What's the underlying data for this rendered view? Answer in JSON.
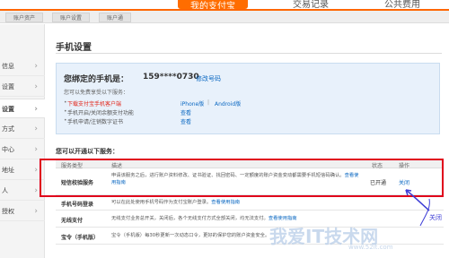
{
  "topnav": {
    "partial_left": "",
    "active": "我的支付宝",
    "item2": "交易记录",
    "item3": "公共费用"
  },
  "subnav": {
    "items": [
      "账户资产",
      "账户设置",
      "账户通"
    ]
  },
  "sidebar": {
    "items": [
      "信息",
      "设置",
      "设置",
      "方式",
      "中心",
      "地址",
      "人",
      "授权"
    ],
    "active_index": 2
  },
  "page": {
    "title": "手机设置"
  },
  "infobox": {
    "bound_label": "您绑定的手机是：",
    "phone": "159****0730",
    "modify_link": "修改号码",
    "services_intro": "您可以免费享受以下服务：",
    "services": [
      {
        "text": "下载支付宝手机客户端",
        "highlight": true
      },
      {
        "text": "手机开启/关闭余额支付功能",
        "highlight": false
      },
      {
        "text": "手机申请/注销数字证书",
        "highlight": false
      }
    ],
    "iphone_link": "iPhone版",
    "android_link": "Android版",
    "view_link_1": "查看",
    "view_link_2": "查看"
  },
  "section": {
    "title": "您可以开通以下服务："
  },
  "table": {
    "headers": {
      "type": "服务类型",
      "desc": "描述",
      "status": "状态",
      "op": "操作"
    },
    "rows": [
      {
        "name": "短信校验服务",
        "desc": "申请该服务之后，进行账户资料修改、证书验证、找回密码、一定额度的账户资金变动都需要手机短信码确认。",
        "desc_link": "查看使用指南",
        "status": "已开通",
        "op": "关闭"
      },
      {
        "name": "手机号码登录",
        "desc": "可以在此处使用手机号码作为支付宝账户登录。",
        "desc_link": "查看使用指南",
        "status": "",
        "op": ""
      },
      {
        "name": "无线支付",
        "desc": "无线支付业务总开关，关闭后，各个无线支付方式全部关闭，均无法支付。",
        "desc_link": "查看使用指南",
        "status": "",
        "op": ""
      },
      {
        "name": "宝令（手机版）",
        "desc": "宝令（手机版）每30秒更新一次动态口令，更好的保护您的账户资金安全。",
        "desc_link": "",
        "status": "",
        "op": ""
      }
    ]
  },
  "annotation": {
    "close_label": "关闭",
    "arrow_color": "#3d3dd6",
    "frame_color": "#e0001b"
  },
  "watermark": {
    "text": "我爱IT技术网",
    "sub": "www.52it.com"
  },
  "colors": {
    "brand_orange": "#ff6600",
    "link_blue": "#0b68c2",
    "infobox_bg": "#e8f1fb"
  }
}
